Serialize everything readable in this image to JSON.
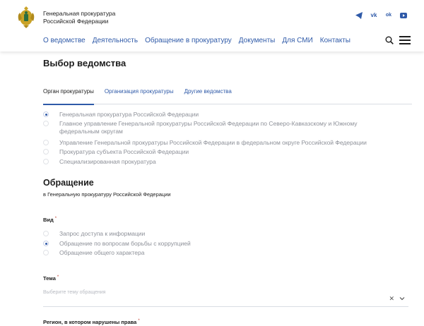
{
  "header": {
    "org_line1": "Генеральная прокуратура",
    "org_line2": "Российской Федерации",
    "social": [
      {
        "icon": "telegram-icon",
        "glyph": ""
      },
      {
        "icon": "vk-icon",
        "glyph": "vk"
      },
      {
        "icon": "odnoklassniki-icon",
        "glyph": "ok"
      },
      {
        "icon": "youtube-icon",
        "glyph": ""
      }
    ],
    "nav": [
      "О ведомстве",
      "Деятельность",
      "Обращение в прокуратуру",
      "Документы",
      "Для СМИ",
      "Контакты"
    ],
    "accent": "#2f5aa8"
  },
  "main": {
    "title": "Выбор ведомства",
    "tabs": [
      "Орган прокуратуры",
      "Организация прокуратуры",
      "Другие ведомства"
    ],
    "agencies": [
      {
        "label": "Генеральная прокуратура Российской Федерации",
        "checked": true
      },
      {
        "label": "Главное управление Генеральной прокуратуры Российской Федерации по Северо-Кавказскому и Южному федеральным округам",
        "checked": false
      },
      {
        "label": "Управление Генеральной прокуратуры Российской Федерации в федеральном округе Российской Федерации",
        "checked": false
      },
      {
        "label": "Прокуратура субъекта Российской Федерации",
        "checked": false
      },
      {
        "label": "Специализированная прокуратура",
        "checked": false
      }
    ],
    "appeal_title": "Обращение",
    "appeal_subtitle": "в Генеральную прокуратуру Российской Федерации",
    "kind_label": "Вид",
    "kinds": [
      {
        "label": "Запрос доступа к информации",
        "checked": false
      },
      {
        "label": "Обращение по вопросам борьбы с коррупцией",
        "checked": true
      },
      {
        "label": "Обращение общего характера",
        "checked": false
      }
    ],
    "topic_label": "Тема",
    "topic_placeholder": "Выберите тему обращения",
    "region_label": "Регион, в котором нарушены права",
    "required_mark": "*"
  }
}
